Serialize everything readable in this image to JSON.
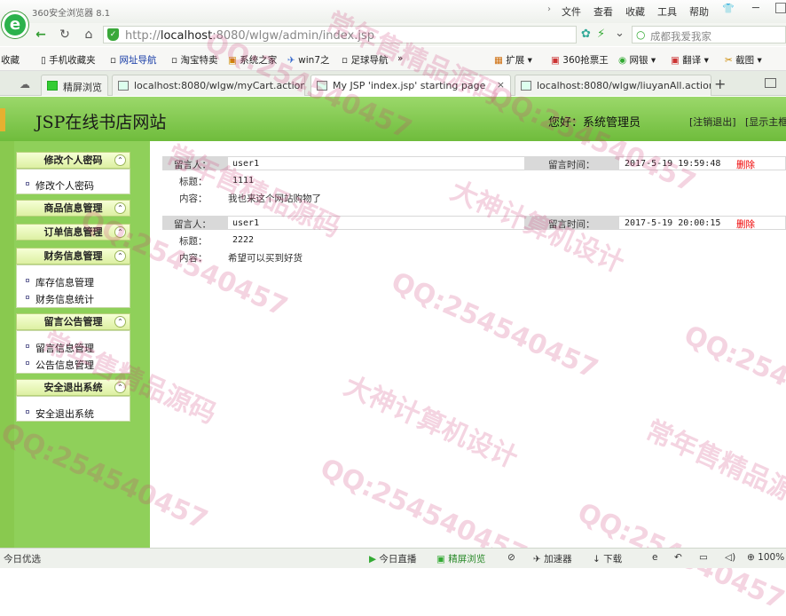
{
  "browser": {
    "title": "360安全浏览器 8.1",
    "menu": [
      "文件",
      "查看",
      "收藏",
      "工具",
      "帮助"
    ],
    "url_prefix": "http://",
    "url_host": "localhost",
    "url_path": ":8080/wlgw/admin/index.jsp",
    "search_placeholder": "成都我爱我家",
    "bookmarks": [
      "收藏",
      "手机收藏夹",
      "网址导航",
      "淘宝特卖",
      "系统之家",
      "win7之",
      "足球导航",
      "»",
      "扩展",
      "360抢票王",
      "网银",
      "翻译",
      "截图"
    ],
    "tabs": [
      {
        "label": "精屏浏览"
      },
      {
        "label": "localhost:8080/wlgw/myCart.action"
      },
      {
        "label": "My JSP 'index.jsp' starting page"
      },
      {
        "label": "localhost:8080/wlgw/liuyanAll.action"
      }
    ],
    "new_tab": "+",
    "status": {
      "left": "今日优选",
      "items": [
        "今日直播",
        "精屏浏览",
        "加速器",
        "下载",
        "100%"
      ]
    }
  },
  "site": {
    "title": "JSP在线书店网站",
    "welcome": "您好：系统管理员",
    "logout": "[注销退出]",
    "show_main": "[显示主框架]"
  },
  "sidebar": [
    {
      "title": "修改个人密码",
      "items": [
        "修改个人密码"
      ]
    },
    {
      "title": "商品信息管理",
      "items": []
    },
    {
      "title": "订单信息管理",
      "items": []
    },
    {
      "title": "财务信息管理",
      "items": [
        "库存信息管理",
        "财务信息统计"
      ]
    },
    {
      "title": "留言公告管理",
      "items": [
        "留言信息管理",
        "公告信息管理"
      ]
    },
    {
      "title": "安全退出系统",
      "items": [
        "安全退出系统"
      ]
    }
  ],
  "messages_labels": {
    "author": "留言人：",
    "time": "留言时间：",
    "title": "标题：",
    "content": "内容：",
    "delete": "删除"
  },
  "messages": [
    {
      "author": "user1",
      "time": "2017-5-19 19:59:48",
      "title": "1111",
      "content": "我也来这个网站购物了"
    },
    {
      "author": "user1",
      "time": "2017-5-19 20:00:15",
      "title": "2222",
      "content": "希望可以买到好货"
    }
  ],
  "watermarks": [
    "QQ:254540457",
    "大神计算机设计",
    "常年售精品源码"
  ]
}
